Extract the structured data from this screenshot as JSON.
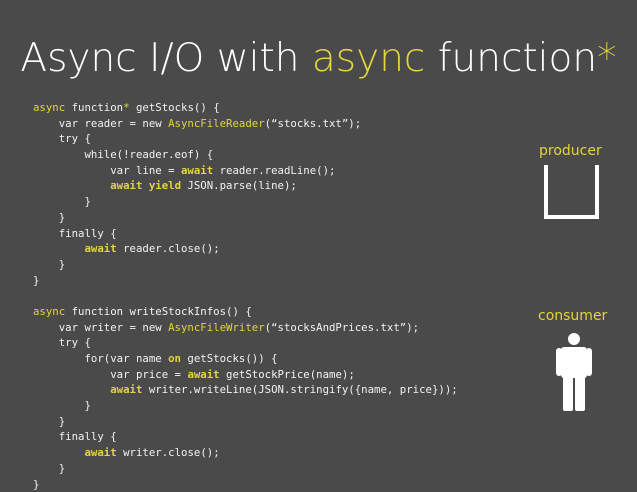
{
  "title": {
    "part1": "Async I/O with ",
    "highlight": "async",
    "part2": " function",
    "star": "*"
  },
  "code": {
    "lines": [
      [
        {
          "t": "async",
          "c": "kw"
        },
        {
          "t": " function"
        },
        {
          "t": "*",
          "c": "kw"
        },
        {
          "t": " getStocks() {"
        }
      ],
      [
        {
          "t": "    var reader = new "
        },
        {
          "t": "AsyncFileReader",
          "c": "kw"
        },
        {
          "t": "(“stocks.txt”);"
        }
      ],
      [
        {
          "t": "    try {"
        }
      ],
      [
        {
          "t": "        while(!reader.eof) {"
        }
      ],
      [
        {
          "t": "            var line = "
        },
        {
          "t": "await",
          "c": "kwb"
        },
        {
          "t": " reader.readLine();"
        }
      ],
      [
        {
          "t": "            "
        },
        {
          "t": "await yield",
          "c": "kwb"
        },
        {
          "t": " JSON.parse(line);"
        }
      ],
      [
        {
          "t": "        }"
        }
      ],
      [
        {
          "t": "    }"
        }
      ],
      [
        {
          "t": "    finally {"
        }
      ],
      [
        {
          "t": "        "
        },
        {
          "t": "await",
          "c": "kwb"
        },
        {
          "t": " reader.close();"
        }
      ],
      [
        {
          "t": "    }"
        }
      ],
      [
        {
          "t": "}"
        }
      ],
      [
        {
          "t": ""
        }
      ],
      [
        {
          "t": "async",
          "c": "kw"
        },
        {
          "t": " function writeStockInfos() {"
        }
      ],
      [
        {
          "t": "    var writer = new "
        },
        {
          "t": "AsyncFileWriter",
          "c": "kw"
        },
        {
          "t": "(“stocksAndPrices.txt”);"
        }
      ],
      [
        {
          "t": "    try {"
        }
      ],
      [
        {
          "t": "        for(var name "
        },
        {
          "t": "on",
          "c": "kwb"
        },
        {
          "t": " getStocks()) {"
        }
      ],
      [
        {
          "t": "            var price = "
        },
        {
          "t": "await",
          "c": "kwb"
        },
        {
          "t": " getStockPrice(name);"
        }
      ],
      [
        {
          "t": "            "
        },
        {
          "t": "await",
          "c": "kwb"
        },
        {
          "t": " writer.writeLine(JSON.stringify({name, price}));"
        }
      ],
      [
        {
          "t": "        }"
        }
      ],
      [
        {
          "t": "    }"
        }
      ],
      [
        {
          "t": "    finally {"
        }
      ],
      [
        {
          "t": "        "
        },
        {
          "t": "await",
          "c": "kwb"
        },
        {
          "t": " writer.close();"
        }
      ],
      [
        {
          "t": "    }"
        }
      ],
      [
        {
          "t": "}"
        }
      ]
    ]
  },
  "producer_label": "producer",
  "consumer_label": "consumer",
  "icons": {
    "producer": "empty-container-icon",
    "consumer": "person-icon"
  },
  "colors": {
    "background": "#4a4a4a",
    "accent": "#e3d440",
    "text": "#f2f2f2"
  }
}
